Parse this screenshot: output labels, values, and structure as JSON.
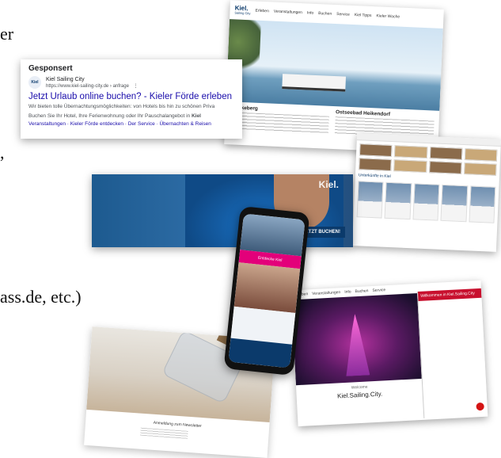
{
  "background_text": {
    "line1": "er",
    "line2": ",",
    "line3": "ass.de, etc.)"
  },
  "ad": {
    "sponsored": "Gesponsert",
    "site_name": "Kiel Sailing City",
    "favicon": "Kiel",
    "url": "https://www.kiel-sailing-city.de › anfrage",
    "more_menu": "⋮",
    "headline": "Jetzt Urlaub online buchen? - Kieler Förde erleben",
    "description_line1": "Wir bieten tolle Übernachtungsmöglichkeiten: von Hotels bis hin zu schönen Priva",
    "description_line2_pre": "Buchen Sie Ihr Hotel, Ihre Ferienwohnung oder Ihr Pauschalangebot in ",
    "description_line2_bold": "Kiel",
    "sitelinks": "Veranstaltungen · Kieler Förde entdecken · Der Service · Übernachten & Reisen"
  },
  "web1": {
    "logo": "Kiel.",
    "logo_sub": "Sailing City",
    "nav": [
      "Erleben",
      "Veranstaltungen",
      "Info",
      "Buchen",
      "Service",
      "Kiel Tipps",
      "Kieler Woche"
    ],
    "col1_title": "Mönkeberg",
    "col2_title": "Ostseebad Heikendorf"
  },
  "web2": {
    "title": "Unterkünfte in Kiel"
  },
  "banner": {
    "logo": "Kiel.",
    "cta": "JETZT BUCHEN!"
  },
  "phone": {
    "pink_label": "Entdecke Kiel"
  },
  "web3": {
    "nav": [
      "Erleben",
      "Veranstaltungen",
      "Info",
      "Buchen",
      "Service"
    ],
    "chat_title": "Willkommen in Kiel.Sailing.City",
    "subtitle": "Welcome",
    "brand": "Kiel.Sailing.City."
  },
  "web4": {
    "title": "Anmeldung zum Newsletter"
  },
  "colors": {
    "link": "#1a0dab",
    "brand_navy": "#0b3a6b",
    "accent_red": "#c8102e"
  }
}
